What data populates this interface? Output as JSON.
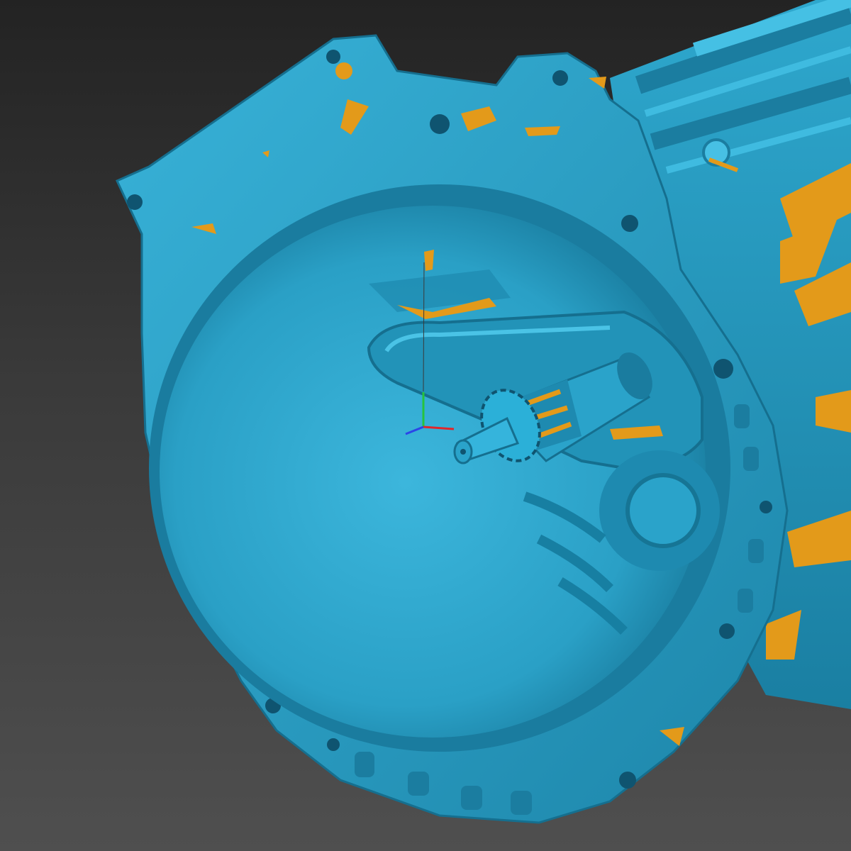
{
  "viewport": {
    "background_top": "#232323",
    "background_bottom": "#4f4f4f"
  },
  "model": {
    "name_icon": "transmission-bellhousing-mesh",
    "surface_color": "#2aa6cc",
    "surface_dark": "#16708f",
    "surface_light": "#5cc6e6",
    "backface_color": "#e39a1a"
  },
  "axis_gizmo": {
    "x_color": "#e0262b",
    "y_color": "#27c33d",
    "z_color": "#2b45e8"
  }
}
